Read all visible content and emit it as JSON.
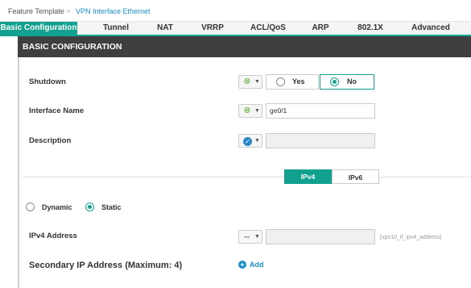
{
  "breadcrumb": {
    "root": "Feature Template",
    "separator": ">",
    "current": "VPN Interface Ethernet"
  },
  "tabs": [
    {
      "label": "Basic Configuration",
      "active": true
    },
    {
      "label": "Tunnel",
      "active": false
    },
    {
      "label": "NAT",
      "active": false
    },
    {
      "label": "VRRP",
      "active": false
    },
    {
      "label": "ACL/QoS",
      "active": false
    },
    {
      "label": "ARP",
      "active": false
    },
    {
      "label": "802.1X",
      "active": false
    },
    {
      "label": "Advanced",
      "active": false
    }
  ],
  "section": {
    "title": "BASIC CONFIGURATION"
  },
  "shutdown": {
    "label": "Shutdown",
    "scope_icon": "globe-icon",
    "options": [
      "Yes",
      "No"
    ],
    "selected": "No"
  },
  "interface_name": {
    "label": "Interface Name",
    "scope_icon": "globe-icon",
    "value": "ge0/1"
  },
  "description": {
    "label": "Description",
    "scope_icon": "check-circle-icon",
    "value": ""
  },
  "ip_version": {
    "options": [
      "IPv4",
      "IPv6"
    ],
    "selected": "IPv4"
  },
  "addressing": {
    "options": [
      "Dynamic",
      "Static"
    ],
    "selected": "Static"
  },
  "ipv4_address": {
    "label": "IPv4 Address",
    "scope_icon": "device-icon",
    "value": "",
    "hint": "[vpn10_if_ipv4_address]"
  },
  "secondary": {
    "label": "Secondary IP Address (Maximum: 4)",
    "add_label": "Add"
  },
  "colors": {
    "accent": "#12a08f",
    "link": "#1a8fc9",
    "header": "#3f3f3f",
    "global": "#52a11e"
  }
}
